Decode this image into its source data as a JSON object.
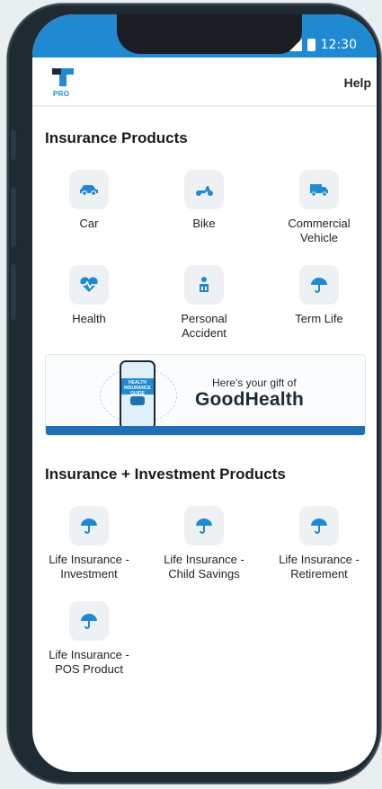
{
  "status_bar": {
    "time": "12:30"
  },
  "header": {
    "logo_text": "PRO",
    "help_label": "Help"
  },
  "insurance_products": {
    "title": "Insurance Products",
    "items": [
      {
        "label": "Car",
        "icon": "car-icon"
      },
      {
        "label": "Bike",
        "icon": "scooter-icon"
      },
      {
        "label": "Commercial\nVehicle",
        "icon": "truck-icon"
      },
      {
        "label": "Health",
        "icon": "heart-pulse-icon"
      },
      {
        "label": "Personal\nAccident",
        "icon": "person-accident-icon"
      },
      {
        "label": "Term Life",
        "icon": "umbrella-icon"
      }
    ]
  },
  "banner": {
    "tagline": "Here's your gift of",
    "headline": "GoodHealth",
    "phone_text": "HEALTH INSURANCE GUIDE"
  },
  "investment_products": {
    "title": "Insurance + Investment Products",
    "items": [
      {
        "label": "Life Insurance -\nInvestment",
        "icon": "umbrella-icon"
      },
      {
        "label": "Life Insurance -\nChild Savings",
        "icon": "umbrella-icon"
      },
      {
        "label": "Life Insurance -\nRetirement",
        "icon": "umbrella-icon"
      },
      {
        "label": "Life Insurance -\nPOS Product",
        "icon": "umbrella-icon"
      }
    ]
  },
  "colors": {
    "accent": "#1f8ad1",
    "tile_bg": "#eef1f4",
    "banner_strip": "#1f6fb4"
  }
}
